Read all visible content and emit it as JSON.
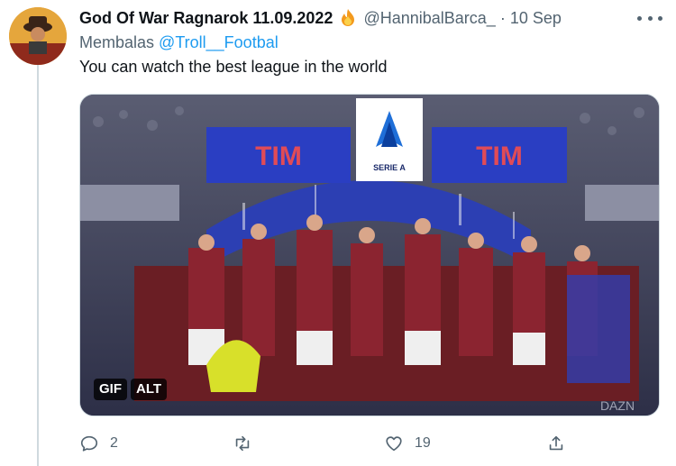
{
  "tweet": {
    "display_name": "God Of War Ragnarok 11.09.2022",
    "name_emoji": "fire-icon",
    "handle": "@HannibalBarca_",
    "separator": "·",
    "time": "10 Sep",
    "replying_prefix": "Membalas",
    "replying_to": "@Troll__Footbal",
    "text": "You can watch the best league in the world",
    "media": {
      "type": "gif",
      "badges": [
        "GIF",
        "ALT"
      ],
      "banner_text_left": "TIM",
      "banner_text_right": "TIM",
      "logo_caption": "SERIE A"
    },
    "actions": {
      "reply_count": "2",
      "retweet_count": "",
      "like_count": "19"
    }
  },
  "colors": {
    "text": "#0f1419",
    "secondary": "#536471",
    "link": "#1d9bf0",
    "divider": "#cfd9de"
  }
}
